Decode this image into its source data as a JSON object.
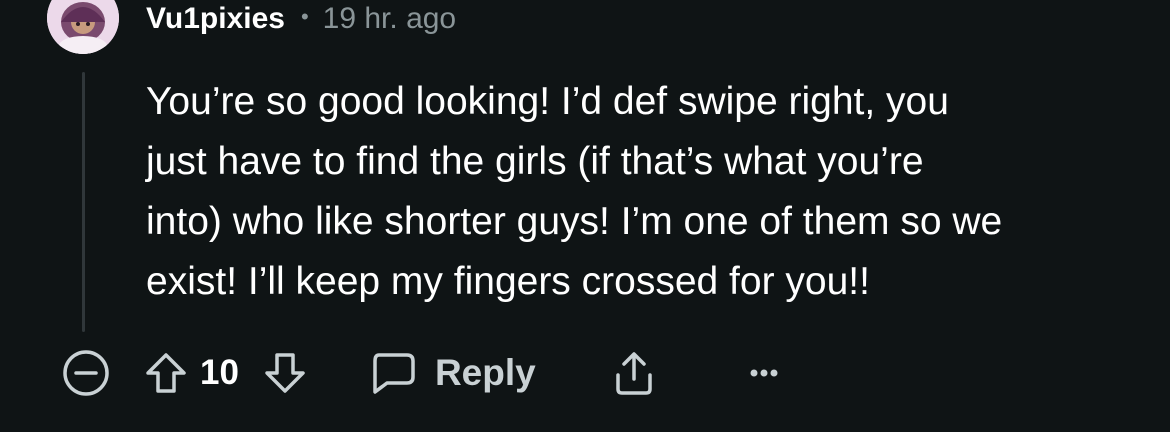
{
  "comment": {
    "username": "Vu1pixies",
    "separator": "•",
    "timestamp": "19 hr. ago",
    "body_lines": [
      "You’re so good looking! I’d def swipe right, you",
      "just have to find the girls (if that’s what you’re",
      "into) who like shorter guys! I’m one of them so we",
      "exist! I’ll keep my fingers crossed for you!!"
    ]
  },
  "actions": {
    "vote_count": "10",
    "reply_label": "Reply"
  },
  "icons": {
    "collapse": "minus-circle-icon",
    "upvote": "arrow-up-icon",
    "downvote": "arrow-down-icon",
    "reply": "chat-bubble-icon",
    "share": "share-icon",
    "more": "ellipsis-icon"
  },
  "colors": {
    "background": "#0f1415",
    "text_primary": "#ffffff",
    "text_secondary": "#8a9598",
    "icon": "#c9d1d4"
  }
}
